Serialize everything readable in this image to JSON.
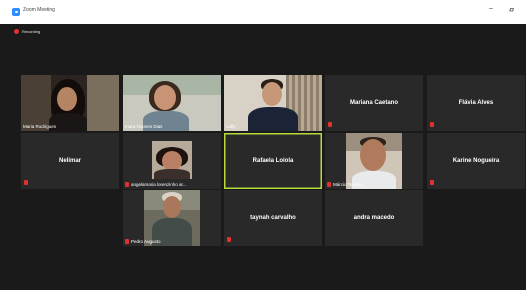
{
  "window": {
    "title": "Zoom Meeting",
    "minimize_glyph": "–",
    "maximize_glyph": "ㅁ"
  },
  "recording": {
    "label": "Recording",
    "color": "#e0312f"
  },
  "colors": {
    "background": "#1a1a1a",
    "tile": "#292929",
    "active_speaker_border": "#b7d93b",
    "muted": "#e0312f"
  },
  "participants": [
    {
      "name": "Maria Rodrigues",
      "video": true,
      "muted": false
    },
    {
      "name": "Inara Tavares Dias",
      "video": true,
      "muted": false
    },
    {
      "name": "Lúffy",
      "video": true,
      "muted": false
    },
    {
      "name": "Mariana Caetano",
      "video": false,
      "muted": true
    },
    {
      "name": "Flávia Alves",
      "video": false,
      "muted": true
    },
    {
      "name": "Nelimar",
      "video": false,
      "muted": true
    },
    {
      "name": "angelamaria lorenzinho ar...",
      "video": true,
      "muted": true
    },
    {
      "name": "Rafaela Loiola",
      "video": false,
      "muted": false,
      "active": true
    },
    {
      "name": "Márcio Teixeira",
      "video": true,
      "muted": true
    },
    {
      "name": "Karine Nogueira",
      "video": false,
      "muted": true
    },
    {
      "name": "Pedro Augusto",
      "video": true,
      "muted": true
    },
    {
      "name": "taynah carvalho",
      "video": false,
      "muted": true
    },
    {
      "name": "andra macedo",
      "video": false,
      "muted": false
    }
  ]
}
